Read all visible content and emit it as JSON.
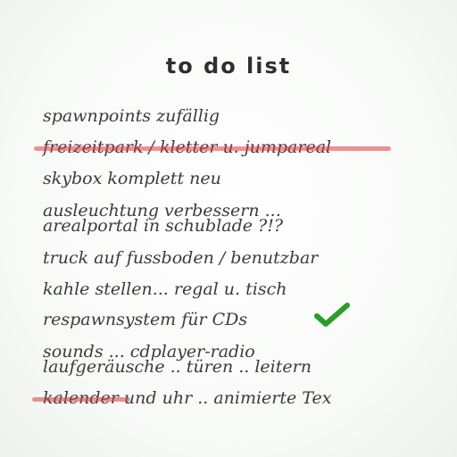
{
  "title": "to do list",
  "items": [
    {
      "text": "spawnpoints zufällig",
      "struck": false
    },
    {
      "text": "freizeitpark / kletter u. jumpareal",
      "struck": true
    },
    {
      "text": "skybox komplett neu",
      "struck": false
    },
    {
      "text": "ausleuchtung verbessern ...",
      "struck": false
    },
    {
      "text": "arealportal in schublade ?!?",
      "struck": false
    },
    {
      "text": "truck auf fussboden / benutzbar",
      "struck": false
    },
    {
      "text": "kahle stellen... regal u. tisch",
      "struck": false
    },
    {
      "text": "respawnsystem für CDs",
      "struck": false,
      "checked": true
    },
    {
      "text": "sounds ... cdplayer-radio",
      "struck": false
    },
    {
      "text": "laufgeräusche .. türen .. leitern",
      "struck": false
    },
    {
      "text": "kalender und uhr .. animierte Tex",
      "struck": true,
      "partial_strike": "kalender"
    }
  ],
  "colors": {
    "strike": "#dc3c3c",
    "check": "#2a9d2a",
    "text": "#3b3b3b"
  },
  "icons": {
    "check": "check-icon"
  }
}
